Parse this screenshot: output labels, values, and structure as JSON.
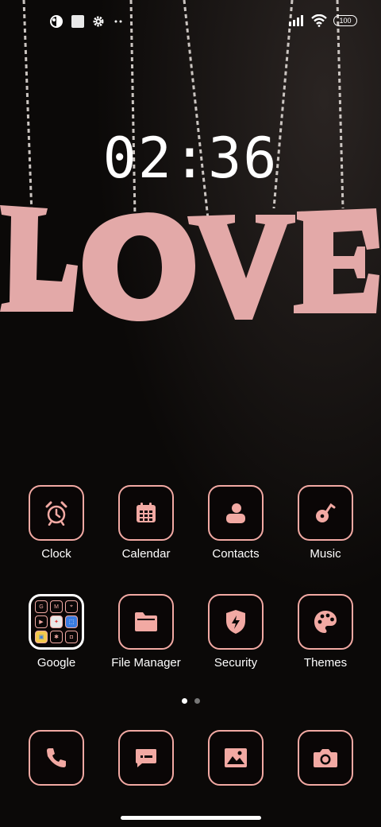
{
  "status_bar": {
    "battery_level": "100",
    "left_icons": [
      "notification-app-icon",
      "notification-square-icon",
      "settings-gear-icon",
      "more-dots-icon"
    ],
    "right_icons": [
      "signal-icon",
      "wifi-icon",
      "battery-icon"
    ]
  },
  "wallpaper": {
    "word": "LOVE"
  },
  "clock": {
    "time": "02:36"
  },
  "apps": [
    {
      "id": "clock",
      "label": "Clock",
      "icon": "alarm-clock-icon"
    },
    {
      "id": "calendar",
      "label": "Calendar",
      "icon": "calendar-icon"
    },
    {
      "id": "contacts",
      "label": "Contacts",
      "icon": "contacts-icon"
    },
    {
      "id": "music",
      "label": "Music",
      "icon": "music-note-icon"
    },
    {
      "id": "google",
      "label": "Google",
      "icon": "google-folder-icon"
    },
    {
      "id": "file-manager",
      "label": "File Manager",
      "icon": "folder-icon"
    },
    {
      "id": "security",
      "label": "Security",
      "icon": "shield-icon"
    },
    {
      "id": "themes",
      "label": "Themes",
      "icon": "palette-icon"
    }
  ],
  "google_folder": {
    "mini_labels": [
      "G",
      "M",
      "⌖",
      "▶",
      "✦",
      "⬚",
      "▣",
      "✱",
      "◘"
    ]
  },
  "dock": [
    {
      "id": "phone",
      "icon": "phone-icon"
    },
    {
      "id": "messages",
      "icon": "message-icon"
    },
    {
      "id": "gallery",
      "icon": "gallery-icon"
    },
    {
      "id": "camera",
      "icon": "camera-icon"
    }
  ],
  "page_indicator": {
    "pages": 2,
    "current": 1
  },
  "colors": {
    "accent": "#f2a9a3",
    "background": "#0b0908",
    "text": "#ffffff"
  }
}
